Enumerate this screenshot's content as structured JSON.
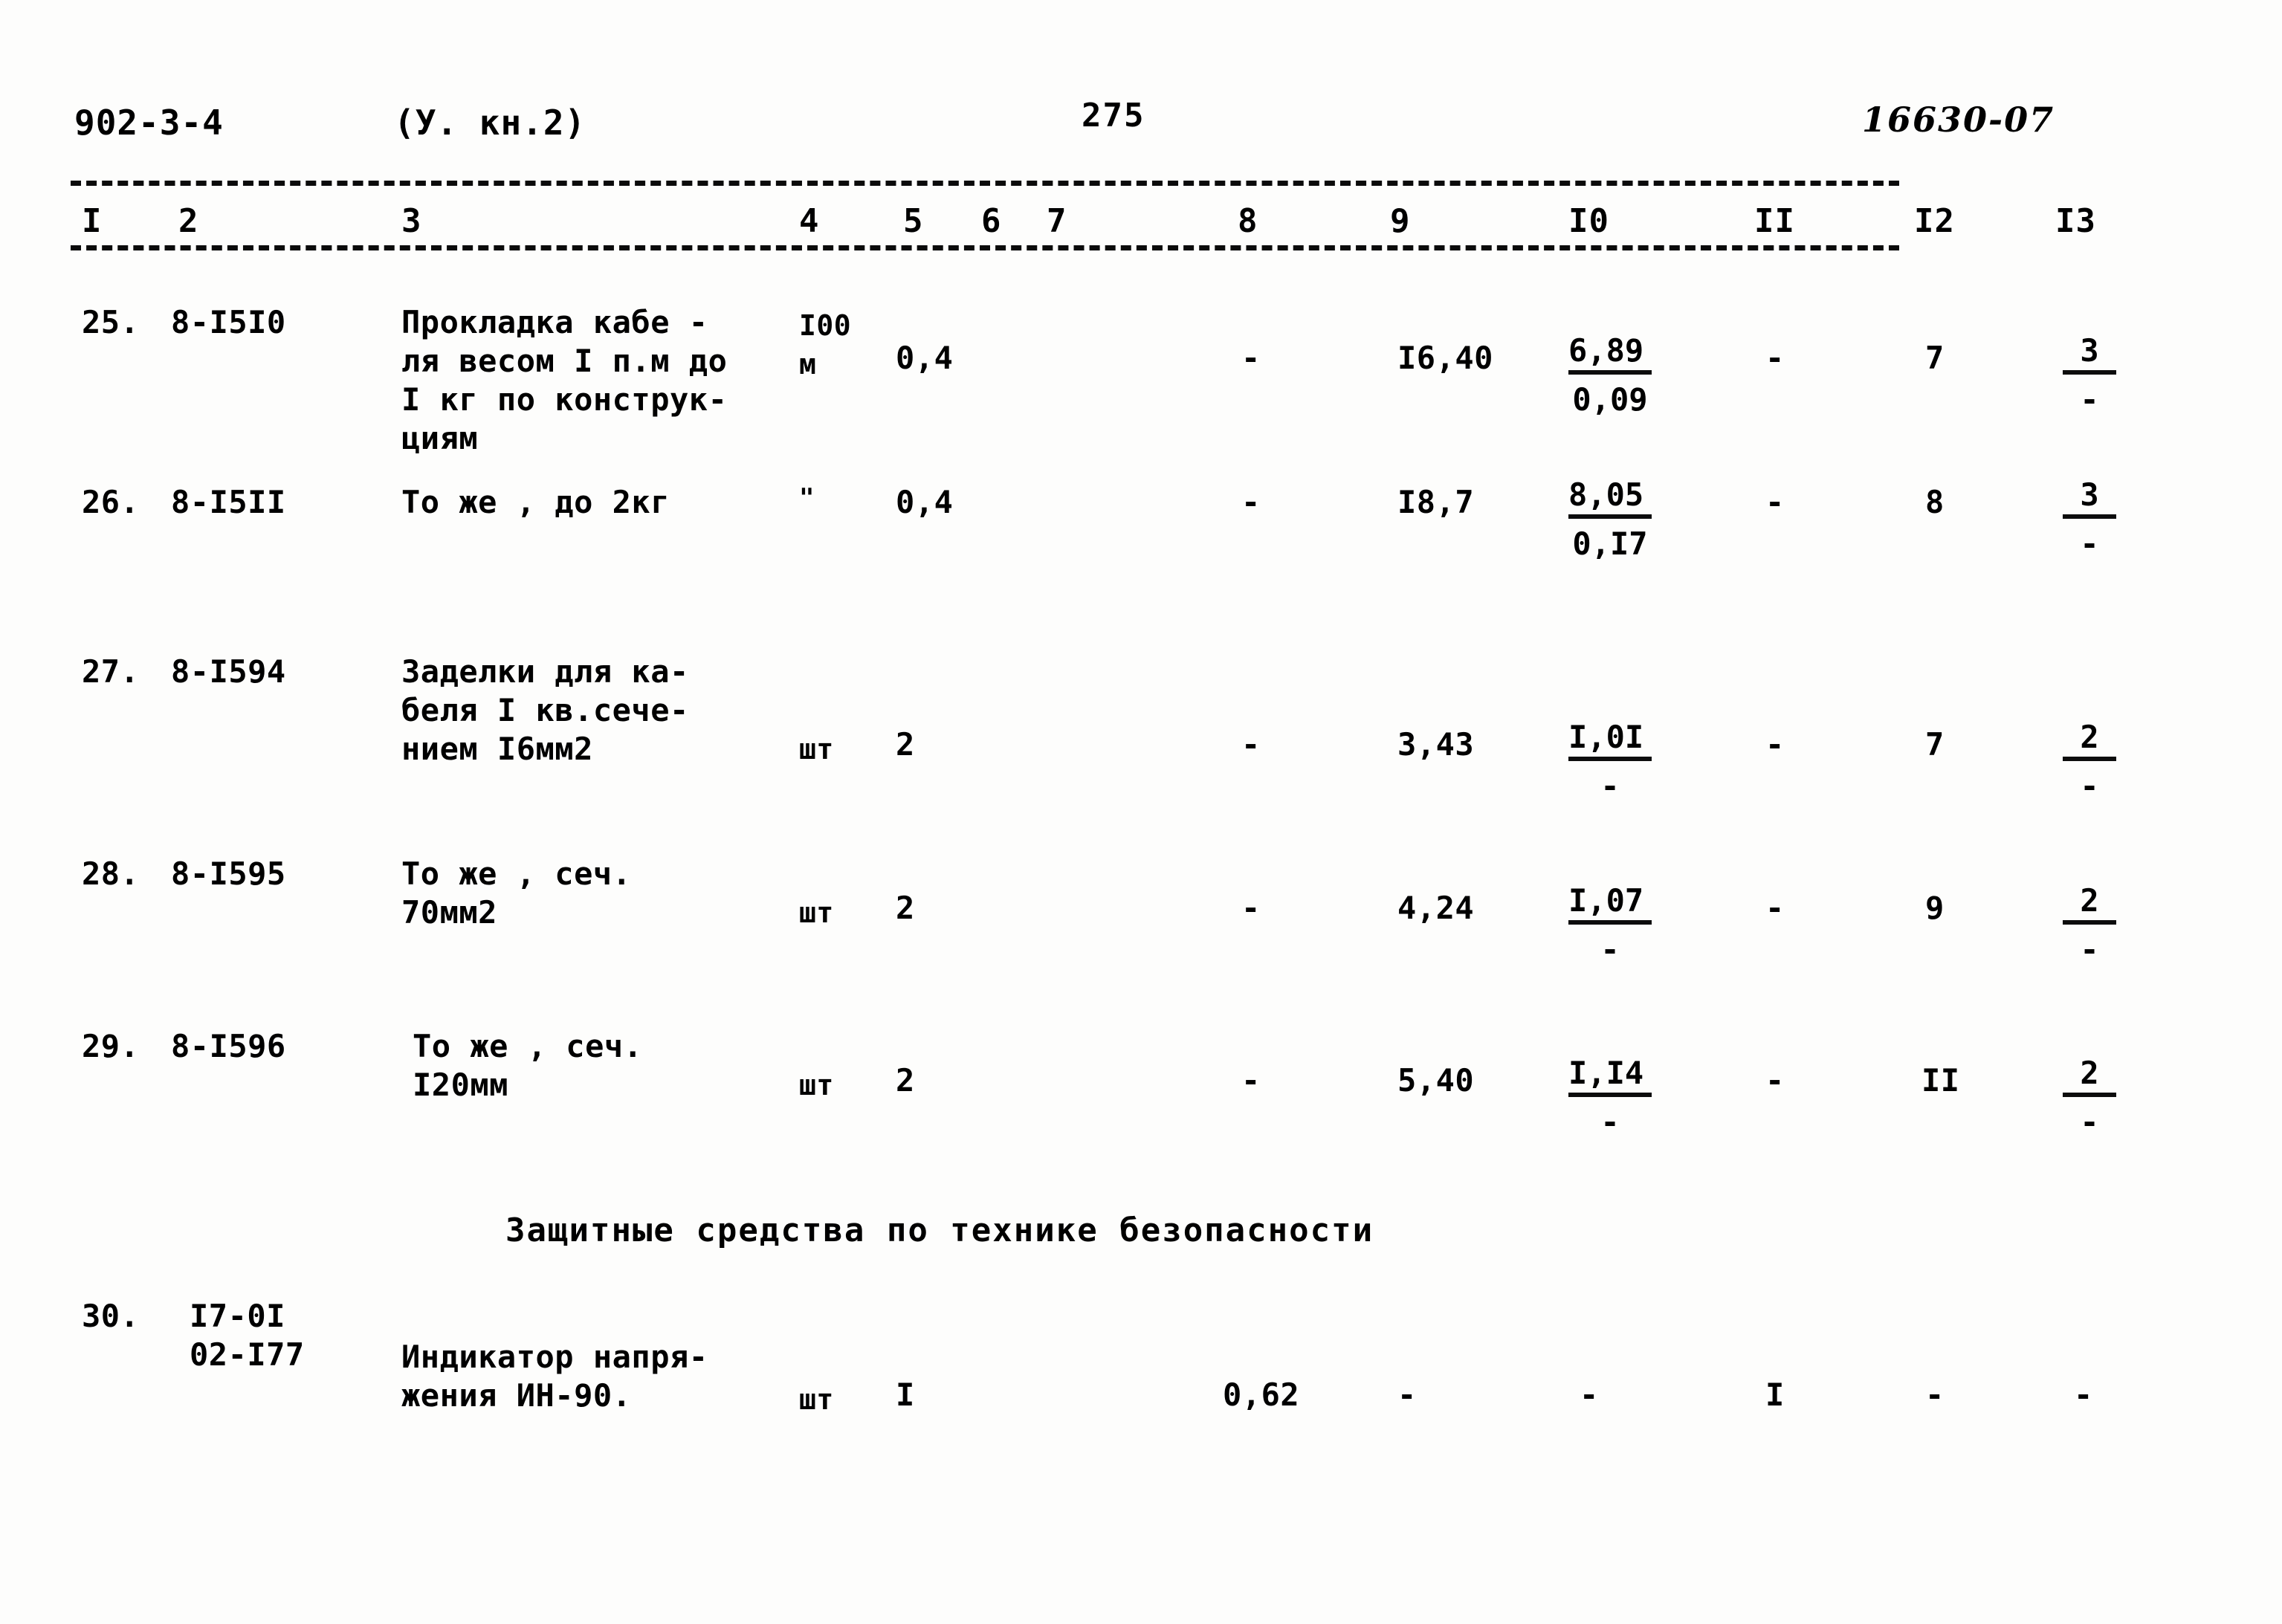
{
  "header": {
    "doc_number": "902-3-4",
    "volume_note": "(У.  кн.2)",
    "page_number": "275",
    "archive_number": "16630-07"
  },
  "table": {
    "column_headers": [
      "I",
      "2",
      "3",
      "4",
      "5",
      "6",
      "7",
      "8",
      "9",
      "I0",
      "II",
      "I2",
      "I3"
    ],
    "rows": [
      {
        "no": "25.",
        "code": "8-I5I0",
        "description": "Прокладка кабе -\nля весом I п.м до\nI кг по конструк-\nциям",
        "unit": "I00\nм",
        "col4": "0,4",
        "col8": "-",
        "col9": "I6,40",
        "col10_top": "6,89",
        "col10_bottom": "0,09",
        "col11": "-",
        "col12": "7",
        "col13_top": "3",
        "col13_bottom": "-"
      },
      {
        "no": "26.",
        "code": "8-I5II",
        "description": "То же , до 2кг",
        "unit": "\"",
        "col4": "0,4",
        "col8": "-",
        "col9": "I8,7",
        "col10_top": "8,05",
        "col10_bottom": "0,I7",
        "col11": "-",
        "col12": "8",
        "col13_top": "3",
        "col13_bottom": "-"
      },
      {
        "no": "27.",
        "code": "8-I594",
        "description": "Заделки для ка-\nбеля I кв.сече-\nнием I6мм2",
        "unit": "шт",
        "col4": "2",
        "col8": "-",
        "col9": "3,43",
        "col10_top": "I,0I",
        "col10_bottom": "-",
        "col11": "-",
        "col12": "7",
        "col13_top": "2",
        "col13_bottom": "-"
      },
      {
        "no": "28.",
        "code": "8-I595",
        "description": "То же , сеч.\n70мм2",
        "unit": "шт",
        "col4": "2",
        "col8": "-",
        "col9": "4,24",
        "col10_top": "I,07",
        "col10_bottom": "-",
        "col11": "-",
        "col12": "9",
        "col13_top": "2",
        "col13_bottom": "-"
      },
      {
        "no": "29.",
        "code": "8-I596",
        "description": "То же , сеч.\nI20мм",
        "unit": "шт",
        "col4": "2",
        "col8": "-",
        "col9": "5,40",
        "col10_top": "I,I4",
        "col10_bottom": "-",
        "col11": "-",
        "col12": "II",
        "col13_top": "2",
        "col13_bottom": "-"
      },
      {
        "no": "30.",
        "code": "I7-0I\n02-I77",
        "description": "Индикатор напря-\nжения ИН-90.",
        "unit": "шт",
        "col4": "I",
        "col8": "0,62",
        "col9": "-",
        "col10_top": "-",
        "col10_bottom": "",
        "col11": "I",
        "col12": "-",
        "col13_top": "-",
        "col13_bottom": ""
      }
    ]
  },
  "section_heading": "Защитные средства по технике безопасности",
  "colors": {
    "ink": "#0b0b0b",
    "paper": "#fdfdfc"
  }
}
